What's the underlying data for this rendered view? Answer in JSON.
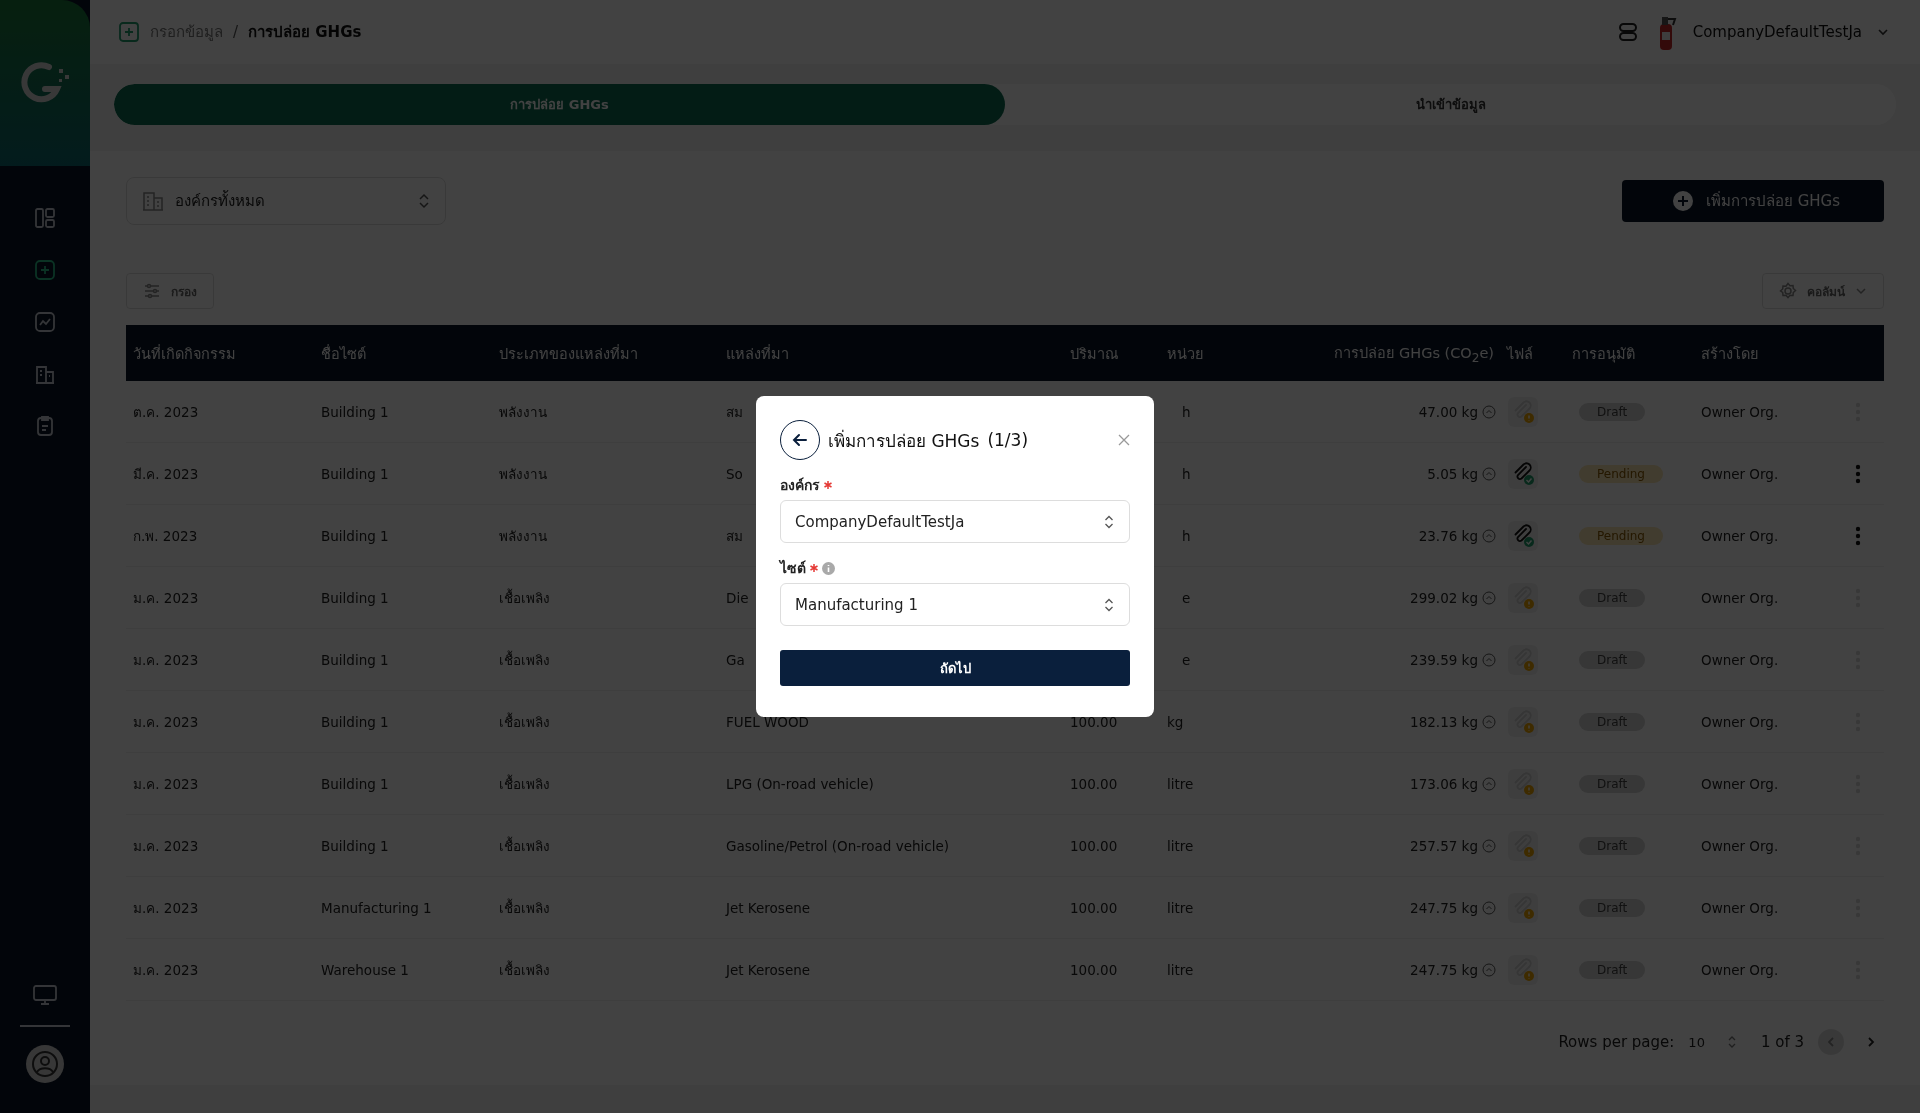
{
  "sidebar": {
    "items": [
      {
        "kind": "dashboard",
        "selected": false
      },
      {
        "kind": "add",
        "selected": true
      },
      {
        "kind": "chart",
        "selected": false
      },
      {
        "kind": "building",
        "selected": false
      },
      {
        "kind": "clipboard",
        "selected": false
      }
    ],
    "bottom_items": [
      {
        "kind": "monitor",
        "selected": false
      },
      {
        "kind": "user"
      }
    ]
  },
  "breadcrumb": [
    "กรอกข้อมูล",
    "/",
    "การปล่อย GHGs"
  ],
  "user": {
    "name": "CompanyDefaultTestJa"
  },
  "tabs": [
    {
      "label": "การปล่อย GHGs",
      "selected": true
    },
    {
      "label": "นำเข้าข้อมูล",
      "selected": false
    }
  ],
  "org_select": {
    "value": "องค์กรทั้งหมด"
  },
  "add_button": "เพิ่มการปล่อย GHGs",
  "filter_button": "กรอง",
  "columns_button": "คอลัมน์",
  "table": {
    "columns": [
      "วันที่เกิดกิจกรรม",
      "ชื่อไซต์",
      "ประเภทของแหล่งที่มา",
      "แหล่งที่มา",
      "ปริมาณ",
      "หน่วย",
      "การปล่อย GHGs (CO$_{2}$e)",
      "ไฟล์",
      "การอนุมัติ",
      "สร้างโดย"
    ],
    "rows": [
      {
        "date": "ต.ค. 2023",
        "site": "Building 1",
        "type": "พลังงาน",
        "source": "สม",
        "amount": "",
        "unit": "h",
        "emission": "47.00 kg",
        "file_attached": false,
        "status": {
          "label": "Draft",
          "kind": "draft"
        },
        "created_by": "Owner Org.",
        "menu_enabled": false
      },
      {
        "date": "มี.ค. 2023",
        "site": "Building 1",
        "type": "พลังงาน",
        "source": "So",
        "amount": "",
        "unit": "h",
        "emission": "5.05 kg",
        "file_attached": true,
        "status": {
          "label": "Pending",
          "kind": "pending"
        },
        "created_by": "Owner Org.",
        "menu_enabled": true
      },
      {
        "date": "ก.พ. 2023",
        "site": "Building 1",
        "type": "พลังงาน",
        "source": "สม",
        "amount": "",
        "unit": "h",
        "emission": "23.76 kg",
        "file_attached": true,
        "status": {
          "label": "Pending",
          "kind": "pending"
        },
        "created_by": "Owner Org.",
        "menu_enabled": true
      },
      {
        "date": "ม.ค. 2023",
        "site": "Building 1",
        "type": "เชื้อเพลิง",
        "source": "Die",
        "amount": "",
        "unit": "e",
        "emission": "299.02 kg",
        "file_attached": false,
        "status": {
          "label": "Draft",
          "kind": "draft"
        },
        "created_by": "Owner Org.",
        "menu_enabled": false
      },
      {
        "date": "ม.ค. 2023",
        "site": "Building 1",
        "type": "เชื้อเพลิง",
        "source": "Ga",
        "amount": "",
        "unit": "e",
        "emission": "239.59 kg",
        "file_attached": false,
        "status": {
          "label": "Draft",
          "kind": "draft"
        },
        "created_by": "Owner Org.",
        "menu_enabled": false
      },
      {
        "date": "ม.ค. 2023",
        "site": "Building 1",
        "type": "เชื้อเพลิง",
        "source": "FUEL WOOD",
        "amount": "100.00",
        "unit": "kg",
        "emission": "182.13 kg",
        "file_attached": false,
        "status": {
          "label": "Draft",
          "kind": "draft"
        },
        "created_by": "Owner Org.",
        "menu_enabled": false
      },
      {
        "date": "ม.ค. 2023",
        "site": "Building 1",
        "type": "เชื้อเพลิง",
        "source": "LPG (On-road vehicle)",
        "amount": "100.00",
        "unit": "litre",
        "emission": "173.06 kg",
        "file_attached": false,
        "status": {
          "label": "Draft",
          "kind": "draft"
        },
        "created_by": "Owner Org.",
        "menu_enabled": false
      },
      {
        "date": "ม.ค. 2023",
        "site": "Building 1",
        "type": "เชื้อเพลิง",
        "source": "Gasoline/Petrol (On-road vehicle)",
        "amount": "100.00",
        "unit": "litre",
        "emission": "257.57 kg",
        "file_attached": false,
        "status": {
          "label": "Draft",
          "kind": "draft"
        },
        "created_by": "Owner Org.",
        "menu_enabled": false
      },
      {
        "date": "ม.ค. 2023",
        "site": "Manufacturing 1",
        "type": "เชื้อเพลิง",
        "source": "Jet Kerosene",
        "amount": "100.00",
        "unit": "litre",
        "emission": "247.75 kg",
        "file_attached": false,
        "status": {
          "label": "Draft",
          "kind": "draft"
        },
        "created_by": "Owner Org.",
        "menu_enabled": false
      },
      {
        "date": "ม.ค. 2023",
        "site": "Warehouse 1",
        "type": "เชื้อเพลิง",
        "source": "Jet Kerosene",
        "amount": "100.00",
        "unit": "litre",
        "emission": "247.75 kg",
        "file_attached": false,
        "status": {
          "label": "Draft",
          "kind": "draft"
        },
        "created_by": "Owner Org.",
        "menu_enabled": false
      }
    ]
  },
  "pagination": {
    "rows_per_page_label": "Rows per page:",
    "rows_per_page": "10",
    "range": "1 of 3",
    "prev_disabled": true,
    "next_disabled": false
  },
  "modal": {
    "title": "เพิ่มการปล่อย GHGs",
    "step": "(1/3)",
    "fields": [
      {
        "label": "องค์กร",
        "required": true,
        "info": false,
        "value": "CompanyDefaultTestJa"
      },
      {
        "label": "ไซต์",
        "required": true,
        "info": true,
        "value": "Manufacturing 1"
      }
    ],
    "submit": "ถัดไป"
  }
}
